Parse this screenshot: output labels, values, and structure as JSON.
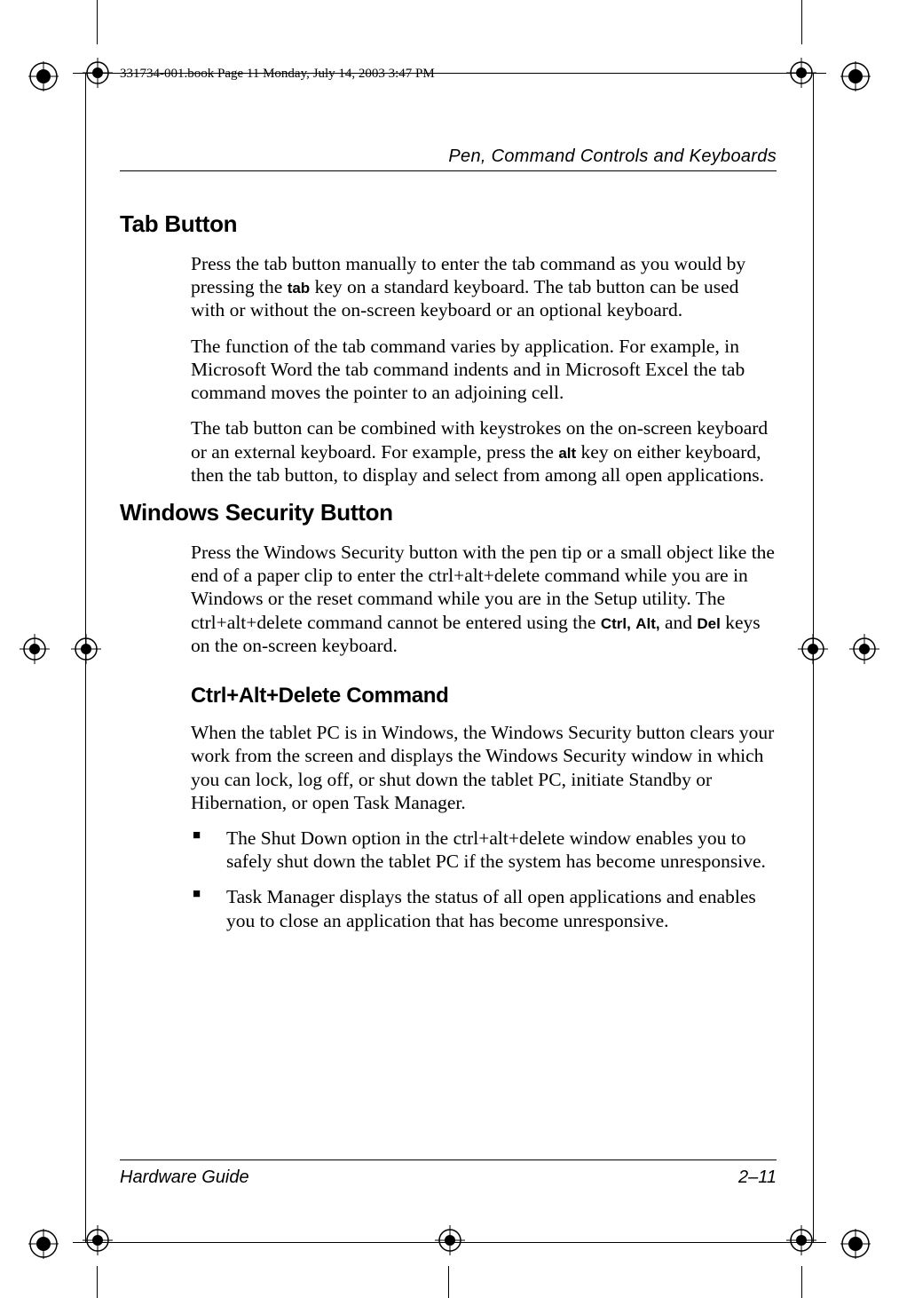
{
  "meta": {
    "filestamp": "331734-001.book  Page 11  Monday, July 14, 2003  3:47 PM"
  },
  "header": {
    "chapter": "Pen, Command Controls and Keyboards"
  },
  "sections": {
    "tab_button": {
      "title": "Tab Button",
      "p1a": "Press the tab button manually to enter the tab command as you would by pressing the ",
      "p1_key": "tab",
      "p1b": " key on a standard keyboard. The tab button can be used with or without the on-screen keyboard or an optional keyboard.",
      "p2": "The function of the tab command varies by application. For example, in Microsoft Word the tab command indents and in Microsoft Excel the tab command moves the pointer to an adjoining cell.",
      "p3a": "The tab button can be combined with keystrokes on the on-screen keyboard or an external keyboard. For example, press the ",
      "p3_key": "alt",
      "p3b": " key on either keyboard, then the tab button, to display and select from among all open applications."
    },
    "win_sec": {
      "title": "Windows Security Button",
      "p1a": "Press the Windows Security button with the pen tip or a small object like the end of a paper clip to enter the ctrl+alt+delete command while you are in Windows or the reset command while you are in the Setup utility. The ctrl+alt+delete command cannot be entered using the ",
      "p1_key1": "Ctrl,",
      "p1_mid": " ",
      "p1_key2": "Alt,",
      "p1b": " and ",
      "p1_key3": "Del",
      "p1c": " keys on the on-screen keyboard."
    },
    "cad": {
      "title": "Ctrl+Alt+Delete Command",
      "p1": "When the tablet PC is in Windows, the Windows Security button clears your work from the screen and displays the Windows Security window in which you can lock, log off, or shut down the tablet PC, initiate Standby or Hibernation, or open Task Manager.",
      "bullets": [
        "The Shut Down option in the ctrl+alt+delete window enables you to safely shut down the tablet PC if the system has become unresponsive.",
        "Task Manager displays the status of all open applications and enables you to close an application that has become unresponsive."
      ]
    }
  },
  "footer": {
    "left": "Hardware Guide",
    "right": "2–11"
  }
}
